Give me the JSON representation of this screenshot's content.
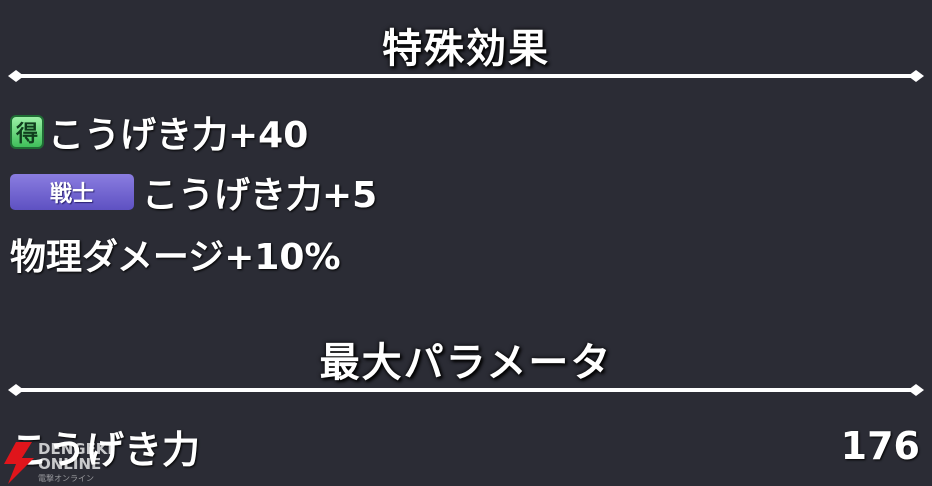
{
  "special_effects": {
    "title": "特殊効果",
    "items": [
      {
        "badge_icon": "得",
        "badge_type": "get-icon",
        "text": "こうげき力+40"
      },
      {
        "badge_label": "戦士",
        "badge_type": "job-badge",
        "text": "こうげき力+5"
      },
      {
        "text": "物理ダメージ+10%"
      }
    ]
  },
  "max_params": {
    "title": "最大パラメータ",
    "rows": [
      {
        "label": "こうげき力",
        "value": "176"
      }
    ]
  },
  "watermark": {
    "line1": "DENGEKI",
    "line2": "ONLINE",
    "sub": "電撃オンライン",
    "icon": "lightning-logo-icon"
  },
  "colors": {
    "background": "#2b2c35",
    "divider": "#ffffff",
    "get_badge": "#3fbf5a",
    "job_badge": "#6a5dd0",
    "logo_red": "#e0151b"
  }
}
